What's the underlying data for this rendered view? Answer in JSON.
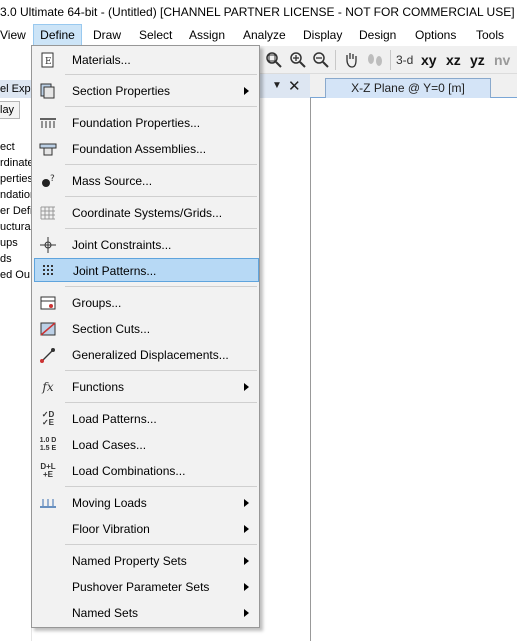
{
  "title": "3.0 Ultimate 64-bit - (Untitled)  [CHANNEL PARTNER LICENSE - NOT FOR COMMERCIAL USE]",
  "menubar": {
    "items": [
      "View",
      "Define",
      "Draw",
      "Select",
      "Assign",
      "Analyze",
      "Display",
      "Design",
      "Options",
      "Tools"
    ]
  },
  "toolbar": {
    "view3d": "3-d",
    "xy": "xy",
    "xz": "xz",
    "yz": "yz",
    "nv": "nv"
  },
  "left_panel": {
    "header": "el Expl",
    "tab": "lay",
    "tree": [
      "ect",
      "rdinate",
      "perties",
      "ndation",
      "er Defi",
      "uctural",
      "ups",
      "ds",
      "ed Ou"
    ]
  },
  "plane_tab": "X-Z Plane @ Y=0 [m]",
  "define_menu": {
    "items": [
      {
        "label": "Materials...",
        "icon": "materials-icon"
      },
      {
        "label": "Section Properties",
        "icon": "section-properties-icon"
      },
      {
        "label": "Foundation Properties...",
        "icon": "foundation-properties-icon"
      },
      {
        "label": "Foundation Assemblies...",
        "icon": "foundation-assemblies-icon"
      },
      {
        "label": "Mass Source...",
        "icon": "mass-source-icon"
      },
      {
        "label": "Coordinate Systems/Grids...",
        "icon": "grid-icon"
      },
      {
        "label": "Joint Constraints...",
        "icon": "joint-constraints-icon"
      },
      {
        "label": "Joint Patterns...",
        "icon": "joint-patterns-icon"
      },
      {
        "label": "Groups...",
        "icon": "groups-icon"
      },
      {
        "label": "Section Cuts...",
        "icon": "section-cuts-icon"
      },
      {
        "label": "Generalized Displacements...",
        "icon": "generalized-displacements-icon"
      },
      {
        "label": "Functions",
        "icon": "functions-icon"
      },
      {
        "label": "Load Patterns...",
        "icon": "load-patterns-icon"
      },
      {
        "label": "Load Cases...",
        "icon": "load-cases-icon"
      },
      {
        "label": "Load Combinations...",
        "icon": "load-combinations-icon"
      },
      {
        "label": "Moving Loads",
        "icon": "moving-loads-icon"
      },
      {
        "label": "Floor Vibration",
        "icon": "floor-vibration-icon"
      },
      {
        "label": "Named Property Sets",
        "icon": ""
      },
      {
        "label": "Pushover Parameter Sets",
        "icon": ""
      },
      {
        "label": "Named Sets",
        "icon": ""
      }
    ],
    "icon_text": {
      "load_patterns": "✓D ✓E",
      "load_cases": "1.0 D 1.5 E",
      "load_combinations": "D+L +E",
      "functions": "fx"
    }
  }
}
